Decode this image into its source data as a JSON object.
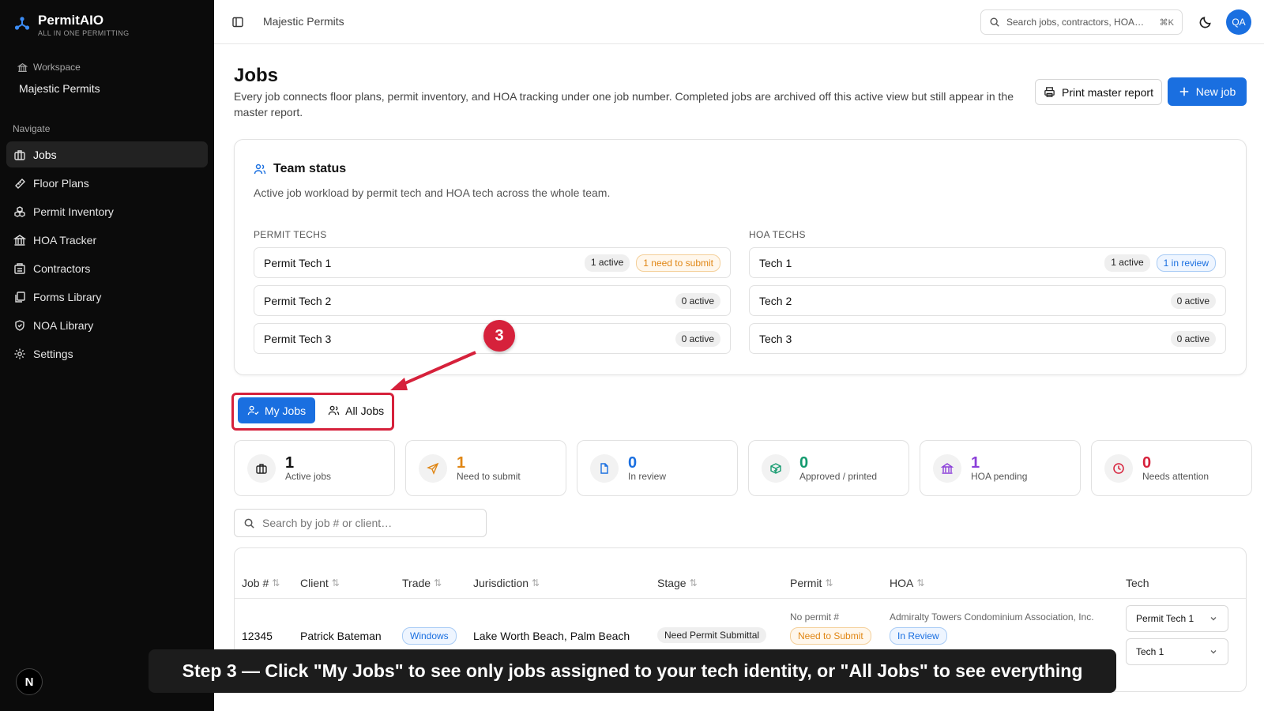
{
  "brand": {
    "name": "PermitAIO",
    "tagline": "ALL IN ONE PERMITTING"
  },
  "workspace": {
    "label": "Workspace",
    "name": "Majestic Permits"
  },
  "nav": {
    "label": "Navigate",
    "items": [
      {
        "label": "Jobs",
        "icon": "briefcase-icon",
        "active": true
      },
      {
        "label": "Floor Plans",
        "icon": "ruler-icon"
      },
      {
        "label": "Permit Inventory",
        "icon": "boxes-icon"
      },
      {
        "label": "HOA Tracker",
        "icon": "landmark-icon"
      },
      {
        "label": "Contractors",
        "icon": "building-icon"
      },
      {
        "label": "Forms Library",
        "icon": "library-icon"
      },
      {
        "label": "NOA Library",
        "icon": "shield-icon"
      },
      {
        "label": "Settings",
        "icon": "gear-icon"
      }
    ]
  },
  "user_badge": "N",
  "topbar": {
    "breadcrumb": "Majestic Permits",
    "search_placeholder": "Search jobs, contractors, HOA…",
    "shortcut": "⌘K",
    "avatar_initials": "QA"
  },
  "page": {
    "title": "Jobs",
    "description": "Every job connects floor plans, permit inventory, and HOA tracking under one job number. Completed jobs are archived off this active view but still appear in the master report.",
    "print_button": "Print master report",
    "new_button": "New job"
  },
  "team": {
    "title": "Team status",
    "subtitle": "Active job workload by permit tech and HOA tech across the whole team.",
    "permit_label": "PERMIT TECHS",
    "hoa_label": "HOA TECHS",
    "permit_techs": [
      {
        "name": "Permit Tech 1",
        "active": "1 active",
        "extra": "1 need to submit"
      },
      {
        "name": "Permit Tech 2",
        "active": "0 active"
      },
      {
        "name": "Permit Tech 3",
        "active": "0 active"
      }
    ],
    "hoa_techs": [
      {
        "name": "Tech 1",
        "active": "1 active",
        "extra": "1 in review"
      },
      {
        "name": "Tech 2",
        "active": "0 active"
      },
      {
        "name": "Tech 3",
        "active": "0 active"
      }
    ]
  },
  "view_toggle": {
    "my_jobs": "My Jobs",
    "all_jobs": "All Jobs",
    "selected": "My Jobs"
  },
  "annotation": {
    "step_number": "3",
    "caption": "Step 3 — Click \"My Jobs\" to see only jobs assigned to your tech identity, or \"All Jobs\" to see everything",
    "color": "#d6213b"
  },
  "stats": [
    {
      "value": "1",
      "label": "Active jobs",
      "color": "#111111",
      "icon": "briefcase-icon"
    },
    {
      "value": "1",
      "label": "Need to submit",
      "color": "#e08614",
      "icon": "send-icon"
    },
    {
      "value": "0",
      "label": "In review",
      "color": "#1a6fe0",
      "icon": "file-icon"
    },
    {
      "value": "0",
      "label": "Approved / printed",
      "color": "#139a6e",
      "icon": "package-check-icon"
    },
    {
      "value": "1",
      "label": "HOA pending",
      "color": "#8b3fd9",
      "icon": "landmark-icon"
    },
    {
      "value": "0",
      "label": "Needs attention",
      "color": "#d6213b",
      "icon": "clock-alert-icon"
    }
  ],
  "job_search": {
    "placeholder": "Search by job # or client…"
  },
  "table": {
    "columns": [
      "Job #",
      "Client",
      "Trade",
      "Jurisdiction",
      "Stage",
      "Permit",
      "HOA",
      "Tech"
    ],
    "rows": [
      {
        "job": "12345",
        "client": "Patrick Bateman",
        "trade": "Windows",
        "jurisdiction": "Lake Worth Beach, Palm Beach",
        "stage": "Need Permit Submittal",
        "permit_no": "No permit #",
        "permit_status": "Need to Submit",
        "hoa_name": "Admiralty Towers Condominium Association, Inc.",
        "hoa_status": "In Review",
        "permit_tech": "Permit Tech 1",
        "hoa_tech": "Tech 1"
      }
    ]
  },
  "colors": {
    "accent": "#1a6fe0",
    "sidebar": "#0b0b0b"
  }
}
